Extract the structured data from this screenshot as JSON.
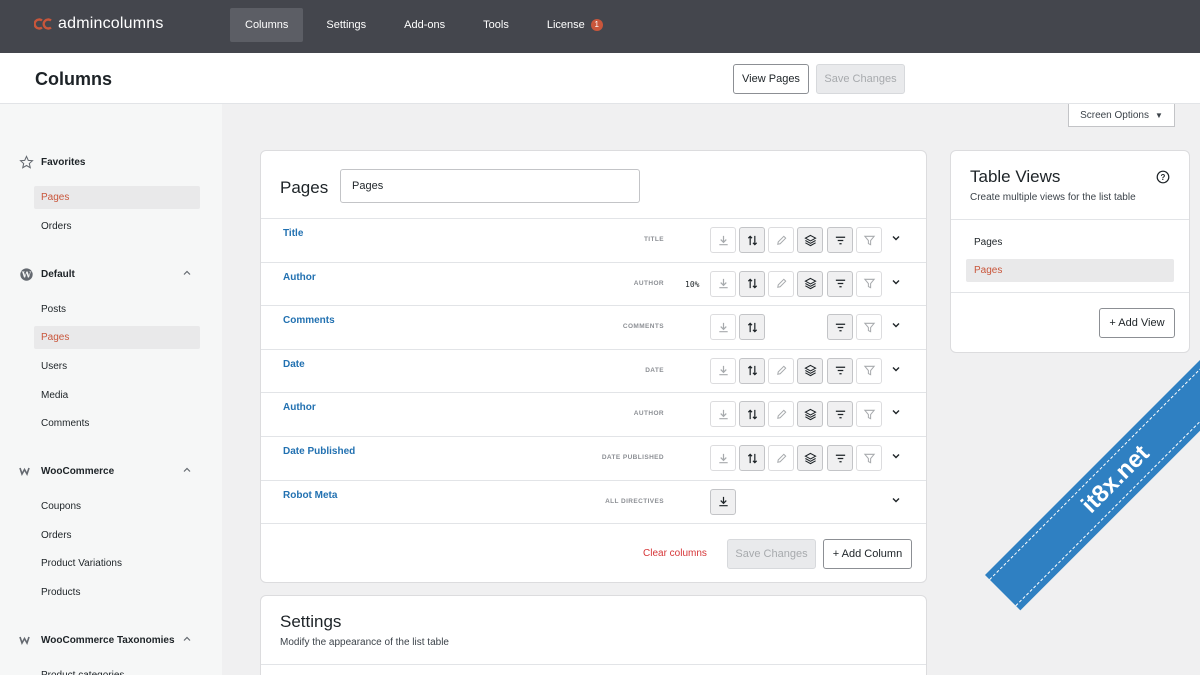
{
  "app": {
    "brand": "admincolumns",
    "brand_color": "#c9563b"
  },
  "nav": {
    "columns": "Columns",
    "settings": "Settings",
    "addons": "Add-ons",
    "tools": "Tools",
    "license": "License",
    "license_badge": "1"
  },
  "header": {
    "title": "Columns",
    "view_button": "View Pages",
    "save_button": "Save Changes",
    "screen_options": "Screen Options"
  },
  "sidebar": {
    "groups": [
      {
        "label": "Favorites",
        "icon": "star-icon",
        "items": [
          "Pages",
          "Orders"
        ]
      },
      {
        "label": "Default",
        "icon": "wordpress-icon",
        "items": [
          "Posts",
          "Pages",
          "Users",
          "Media",
          "Comments"
        ]
      },
      {
        "label": "WooCommerce",
        "icon": "woocommerce-icon",
        "items": [
          "Coupons",
          "Orders",
          "Product Variations",
          "Products"
        ]
      },
      {
        "label": "WooCommerce Taxonomies",
        "icon": "woocommerce-icon",
        "items": [
          "Product categories"
        ]
      }
    ]
  },
  "main": {
    "title": "Pages",
    "title_value": "Pages",
    "columns": [
      {
        "label": "Title",
        "type": "TITLE",
        "width": ""
      },
      {
        "label": "Author",
        "type": "AUTHOR",
        "width": "10%"
      },
      {
        "label": "Comments",
        "type": "COMMENTS",
        "width": ""
      },
      {
        "label": "Date",
        "type": "DATE",
        "width": ""
      },
      {
        "label": "Author",
        "type": "AUTHOR",
        "width": ""
      },
      {
        "label": "Date Published",
        "type": "DATE PUBLISHED",
        "width": ""
      },
      {
        "label": "Robot Meta",
        "type": "ALL DIRECTIVES",
        "width": ""
      }
    ],
    "clear_columns": "Clear columns",
    "save_changes": "Save Changes",
    "add_column": "+ Add Column"
  },
  "table_views": {
    "title": "Table Views",
    "subtitle": "Create multiple views for the list table",
    "items": [
      "Pages",
      "Pages"
    ],
    "add_view": "+ Add View"
  },
  "settings": {
    "title": "Settings",
    "subtitle": "Modify the appearance of the list table"
  },
  "watermark": "it8x.net"
}
